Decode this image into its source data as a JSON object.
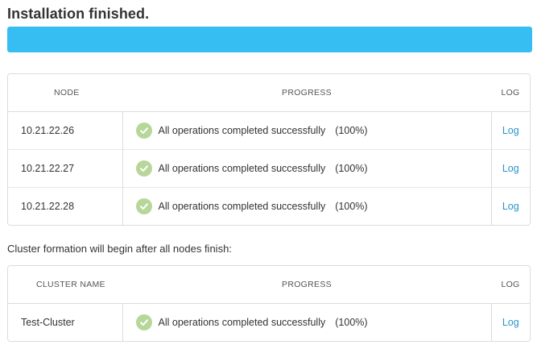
{
  "header": {
    "title": "Installation finished."
  },
  "overall_progress": {
    "percent": 100,
    "fill_color": "#36bdf1"
  },
  "nodes_table": {
    "columns": {
      "node": "NODE",
      "progress": "PROGRESS",
      "log": "LOG"
    },
    "rows": [
      {
        "node": "10.21.22.26",
        "status": "All operations completed successfully",
        "percent": "(100%)",
        "log": "Log"
      },
      {
        "node": "10.21.22.27",
        "status": "All operations completed successfully",
        "percent": "(100%)",
        "log": "Log"
      },
      {
        "node": "10.21.22.28",
        "status": "All operations completed successfully",
        "percent": "(100%)",
        "log": "Log"
      }
    ]
  },
  "cluster_section": {
    "label": "Cluster formation will begin after all nodes finish:"
  },
  "cluster_table": {
    "columns": {
      "name": "CLUSTER NAME",
      "progress": "PROGRESS",
      "log": "LOG"
    },
    "rows": [
      {
        "name": "Test-Cluster",
        "status": "All operations completed successfully",
        "percent": "(100%)",
        "log": "Log"
      }
    ]
  },
  "icons": {
    "status_icon": "check-circle-icon",
    "status_icon_color": "#b7d79a",
    "link_color": "#2a93c9"
  }
}
